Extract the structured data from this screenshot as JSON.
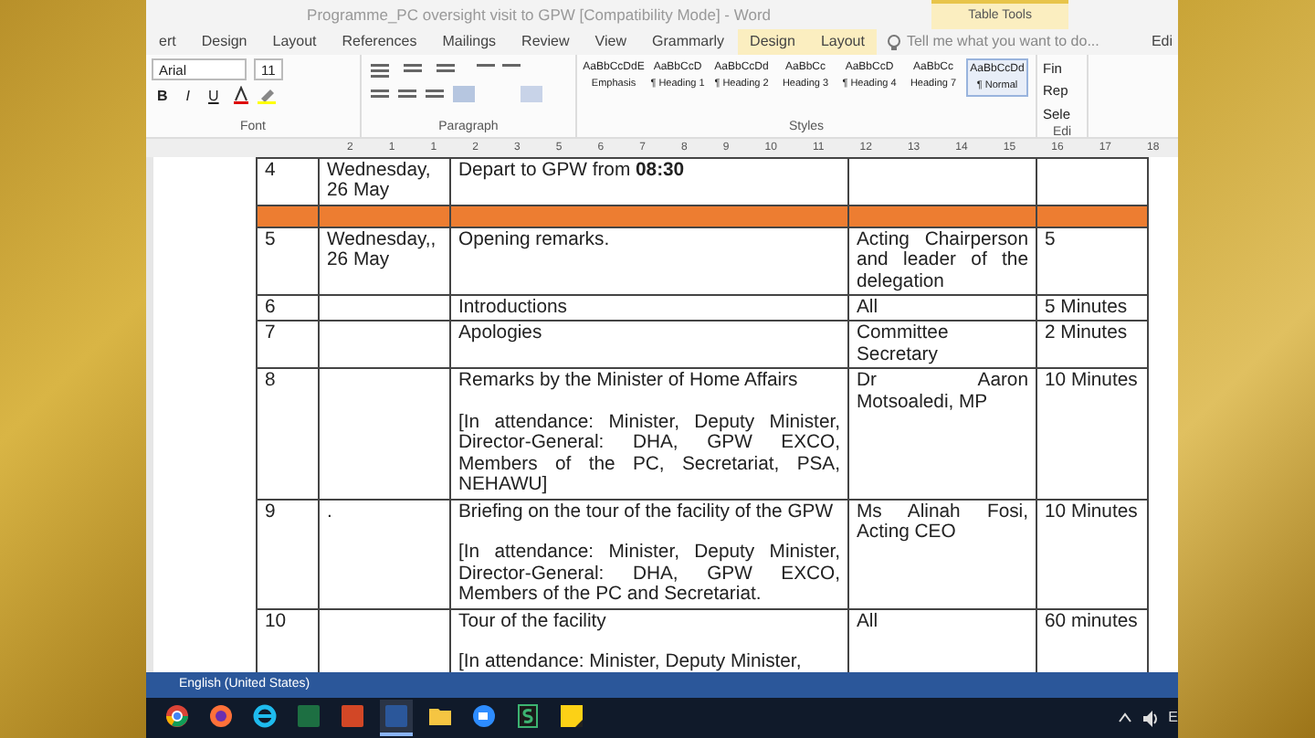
{
  "window": {
    "title": "Programme_PC oversight visit to GPW [Compatibility Mode] - Word",
    "contextual_label": "Table Tools",
    "corner_text": "Edi"
  },
  "ribbon_tabs": [
    {
      "label": "ert",
      "kind": "normal"
    },
    {
      "label": "Design",
      "kind": "normal"
    },
    {
      "label": "Layout",
      "kind": "normal"
    },
    {
      "label": "References",
      "kind": "normal"
    },
    {
      "label": "Mailings",
      "kind": "normal"
    },
    {
      "label": "Review",
      "kind": "normal"
    },
    {
      "label": "View",
      "kind": "normal"
    },
    {
      "label": "Grammarly",
      "kind": "normal"
    },
    {
      "label": "Design",
      "kind": "contextual"
    },
    {
      "label": "Layout",
      "kind": "contextual"
    }
  ],
  "tell_me": {
    "placeholder": "Tell me what you want to do..."
  },
  "ribbon": {
    "font_name": "Arial",
    "font_size": "11",
    "format_buttons": [
      "B",
      "I",
      "U"
    ],
    "styles": [
      {
        "sample": "AaBbCcDdE",
        "name": "Emphasis",
        "selected": false
      },
      {
        "sample": "AaBbCcD",
        "name": "¶ Heading 1",
        "selected": false
      },
      {
        "sample": "AaBbCcDd",
        "name": "¶ Heading 2",
        "selected": false
      },
      {
        "sample": "AaBbCc",
        "name": "Heading 3",
        "selected": false
      },
      {
        "sample": "AaBbCcD",
        "name": "¶ Heading 4",
        "selected": false
      },
      {
        "sample": "AaBbCc",
        "name": "Heading 7",
        "selected": false
      },
      {
        "sample": "AaBbCcDd",
        "name": "¶ Normal",
        "selected": true
      }
    ],
    "editing": [
      "Fin",
      "Rep",
      "Sele"
    ],
    "groups": [
      "Font",
      "Paragraph",
      "Styles",
      "Edi"
    ]
  },
  "ruler": [
    "2",
    "1",
    "1",
    "2",
    "3",
    "5",
    "6",
    "7",
    "8",
    "9",
    "10",
    "11",
    "12",
    "13",
    "14",
    "15",
    "16",
    "17",
    "18"
  ],
  "table_rows": [
    {
      "kind": "row",
      "cells": [
        [
          "4"
        ],
        [
          "Wednesday, 26 May"
        ],
        [
          "Depart to GPW from **08:30**"
        ],
        [],
        []
      ]
    },
    {
      "kind": "separator",
      "cells": []
    },
    {
      "kind": "row",
      "cells": [
        [
          "5"
        ],
        [
          "Wednesday,, 26 May"
        ],
        [
          "Opening remarks."
        ],
        [
          "Acting Chairperson and leader of the delegation"
        ],
        [
          "5"
        ]
      ]
    },
    {
      "kind": "row",
      "cells": [
        [
          "6"
        ],
        [],
        [
          "Introductions"
        ],
        [
          "All"
        ],
        [
          "5 Minutes"
        ]
      ]
    },
    {
      "kind": "row",
      "cells": [
        [
          "7"
        ],
        [],
        [
          "Apologies"
        ],
        [
          "Committee Secretary"
        ],
        [
          "2 Minutes"
        ]
      ]
    },
    {
      "kind": "row",
      "cells": [
        [
          "8"
        ],
        [],
        [
          "Remarks by the Minister of Home Affairs",
          "[In attendance: Minister, Deputy Minister, Director-General: DHA, GPW EXCO, Members of the PC, Secretariat, PSA, NEHAWU]"
        ],
        [
          "Dr Aaron Motsoaledi, MP"
        ],
        [
          "10 Minutes"
        ]
      ]
    },
    {
      "kind": "row",
      "cells": [
        [
          "9"
        ],
        [
          "."
        ],
        [
          "Briefing on the tour of the facility of the GPW",
          "[In attendance:  Minister, Deputy Minister, Director-General: DHA, GPW EXCO, Members of the PC and  Secretariat."
        ],
        [
          "Ms Alinah Fosi, Acting CEO"
        ],
        [
          "10 Minutes"
        ]
      ]
    },
    {
      "kind": "row",
      "cells": [
        [
          "10"
        ],
        [],
        [
          "Tour of the facility",
          "[In attendance:  Minister, Deputy Minister,"
        ],
        [
          "All"
        ],
        [
          "60 minutes"
        ]
      ]
    }
  ],
  "status_bar": {
    "language": "English (United States)"
  },
  "taskbar": {
    "apps": [
      {
        "kind": "chrome",
        "active": false
      },
      {
        "kind": "firefox",
        "active": false
      },
      {
        "kind": "ie",
        "active": false
      },
      {
        "kind": "excel",
        "active": false
      },
      {
        "kind": "powerpoint",
        "active": false
      },
      {
        "kind": "word",
        "active": true
      },
      {
        "kind": "folder",
        "active": false
      },
      {
        "kind": "zoom",
        "active": false
      },
      {
        "kind": "s-app",
        "active": false
      },
      {
        "kind": "notes",
        "active": false
      }
    ],
    "tray_text": "E"
  }
}
